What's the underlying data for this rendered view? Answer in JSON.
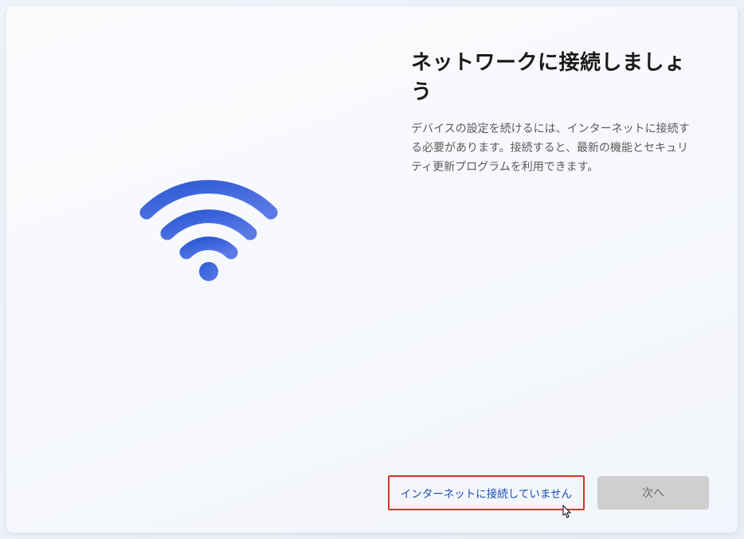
{
  "heading": "ネットワークに接続しましょう",
  "description": "デバイスの設定を続けるには、インターネットに接続する必要があります。接続すると、最新の機能とセキュリティ更新プログラムを利用できます。",
  "buttons": {
    "no_internet": "インターネットに接続していません",
    "next": "次へ"
  }
}
